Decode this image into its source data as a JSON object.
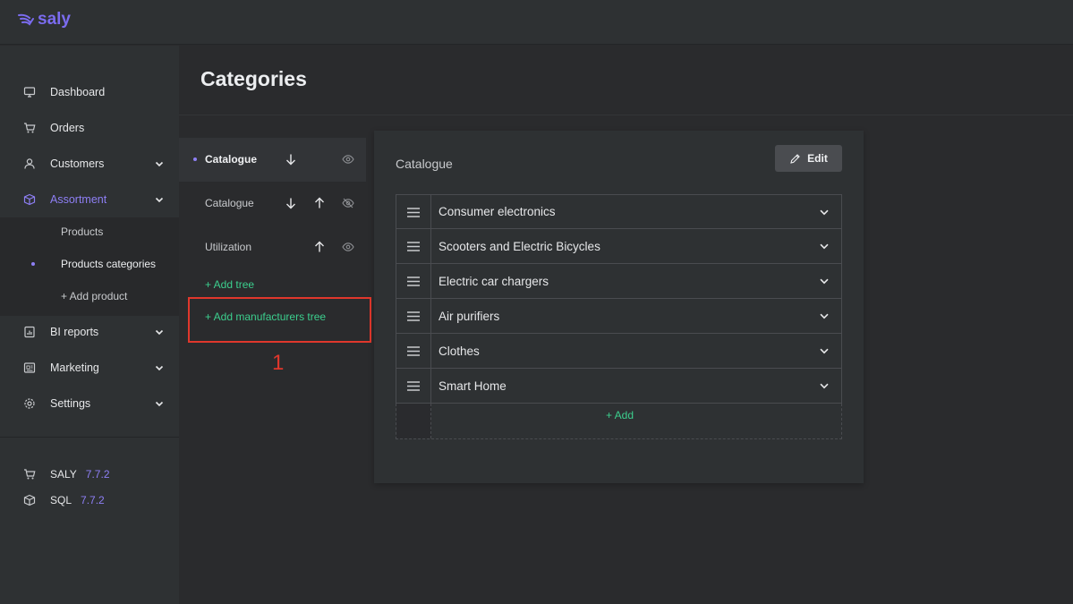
{
  "app": {
    "logo_text": "saly",
    "brand_color": "#7b6cf0",
    "accent_green": "#3ccf8e",
    "annotation_red": "#e0372c"
  },
  "sidebar": {
    "items": [
      {
        "label": "Dashboard",
        "icon": "monitor-icon"
      },
      {
        "label": "Orders",
        "icon": "cart-icon"
      },
      {
        "label": "Customers",
        "icon": "user-icon"
      },
      {
        "label": "Assortment",
        "icon": "box-icon"
      },
      {
        "label": "BI reports",
        "icon": "report-icon"
      },
      {
        "label": "Marketing",
        "icon": "newspaper-icon"
      },
      {
        "label": "Settings",
        "icon": "gear-icon"
      }
    ],
    "subitems": [
      "Products",
      "Products categories",
      "+ Add product"
    ],
    "versions": [
      {
        "name": "SALY",
        "version": "7.7.2"
      },
      {
        "name": "SQL",
        "version": "7.7.2"
      }
    ]
  },
  "page": {
    "title": "Categories"
  },
  "trees": {
    "rows": [
      {
        "name": "Catalogue",
        "controls": [
          "arrow-down-icon",
          "eye-icon"
        ]
      },
      {
        "name": "Catalogue",
        "controls": [
          "arrow-down-icon",
          "arrow-up-icon",
          "eye-off-icon"
        ]
      },
      {
        "name": "Utilization",
        "controls": [
          "arrow-up-icon",
          "eye-icon"
        ]
      }
    ],
    "add_tree": "+ Add tree",
    "add_manufacturers_tree": "+ Add manufacturers tree",
    "annotation_number": "1"
  },
  "panel": {
    "title": "Catalogue",
    "edit_label": "Edit",
    "categories": [
      "Consumer electronics",
      "Scooters and Electric Bicycles",
      "Electric car chargers",
      "Air purifiers",
      "Clothes",
      "Smart Home"
    ],
    "add_label": "+ Add"
  }
}
